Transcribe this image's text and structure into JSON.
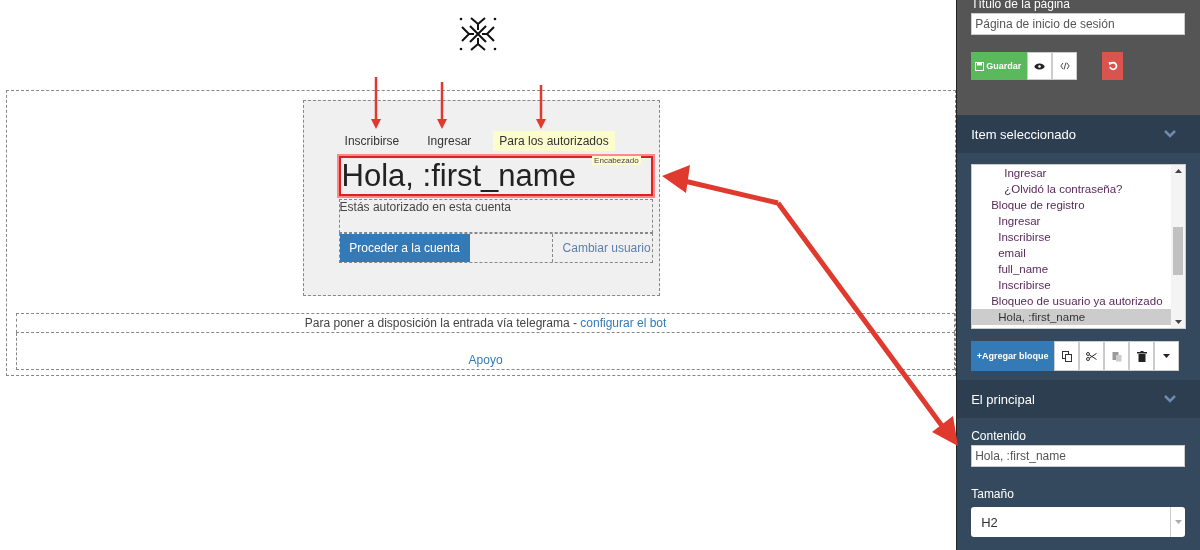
{
  "canvas": {
    "tabs": [
      {
        "label": "Inscribirse",
        "selected": false
      },
      {
        "label": "Ingresar",
        "selected": false
      },
      {
        "label": "Para los autorizados",
        "selected": true
      }
    ],
    "heading": {
      "text": "Hola, :first_name",
      "badge": "Encabezado"
    },
    "message": "Estás autorizado en esta cuenta",
    "primary_button": "Proceder a la cuenta",
    "secondary_link": "Cambiar usuario",
    "telegram": {
      "text": "Para poner a disposición la entrada vía telegrama - ",
      "link": "configurar el bot"
    },
    "support_link": "Apoyo"
  },
  "panel": {
    "title_label": "Título de la página",
    "title_value": "Página de inicio de sesión",
    "save_button": "Guardar",
    "selected_section": {
      "title": "Item seleccionado",
      "tree": [
        {
          "children": [
            {
              "label": "Ingresar",
              "selected": false
            },
            {
              "label": "¿Olvidó la contraseña?",
              "selected": false
            }
          ]
        },
        {
          "label": "Bloque de registro",
          "selected": false,
          "children": [
            {
              "label": "Ingresar",
              "selected": false
            },
            {
              "label": "Inscribirse",
              "selected": false
            },
            {
              "label": "email",
              "selected": false
            },
            {
              "label": "full_name",
              "selected": false
            },
            {
              "label": "Inscribirse",
              "selected": false
            }
          ]
        },
        {
          "label": "Bloqueo de usuario ya autorizado",
          "selected": false,
          "children": [
            {
              "label": "Hola, :first_name",
              "selected": true
            }
          ]
        }
      ],
      "add_button": "+Agregar bloque"
    },
    "main_section": {
      "title": "El principal",
      "content_label": "Contenido",
      "content_value": "Hola, :first_name",
      "size_label": "Tamaño",
      "size_value": "H2"
    }
  }
}
